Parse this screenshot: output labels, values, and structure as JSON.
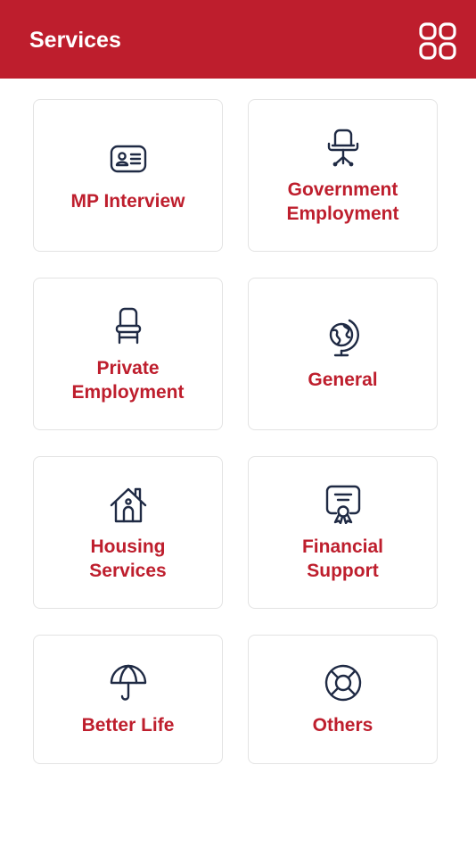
{
  "header": {
    "title": "Services",
    "menu_icon": "grid-icon",
    "background_color": "#BE1E2D"
  },
  "accent_color": "#BE1E2D",
  "icon_color": "#1F2A44",
  "services": [
    {
      "label": "MP Interview",
      "icon": "id-card-icon"
    },
    {
      "label": "Government\nEmployment",
      "icon": "office-chair-icon"
    },
    {
      "label": "Private\nEmployment",
      "icon": "chair-icon"
    },
    {
      "label": "General",
      "icon": "globe-icon"
    },
    {
      "label": "Housing\nServices",
      "icon": "house-icon"
    },
    {
      "label": "Financial\nSupport",
      "icon": "certificate-icon"
    },
    {
      "label": "Better Life",
      "icon": "umbrella-icon"
    },
    {
      "label": "Others",
      "icon": "lifebuoy-icon"
    }
  ]
}
